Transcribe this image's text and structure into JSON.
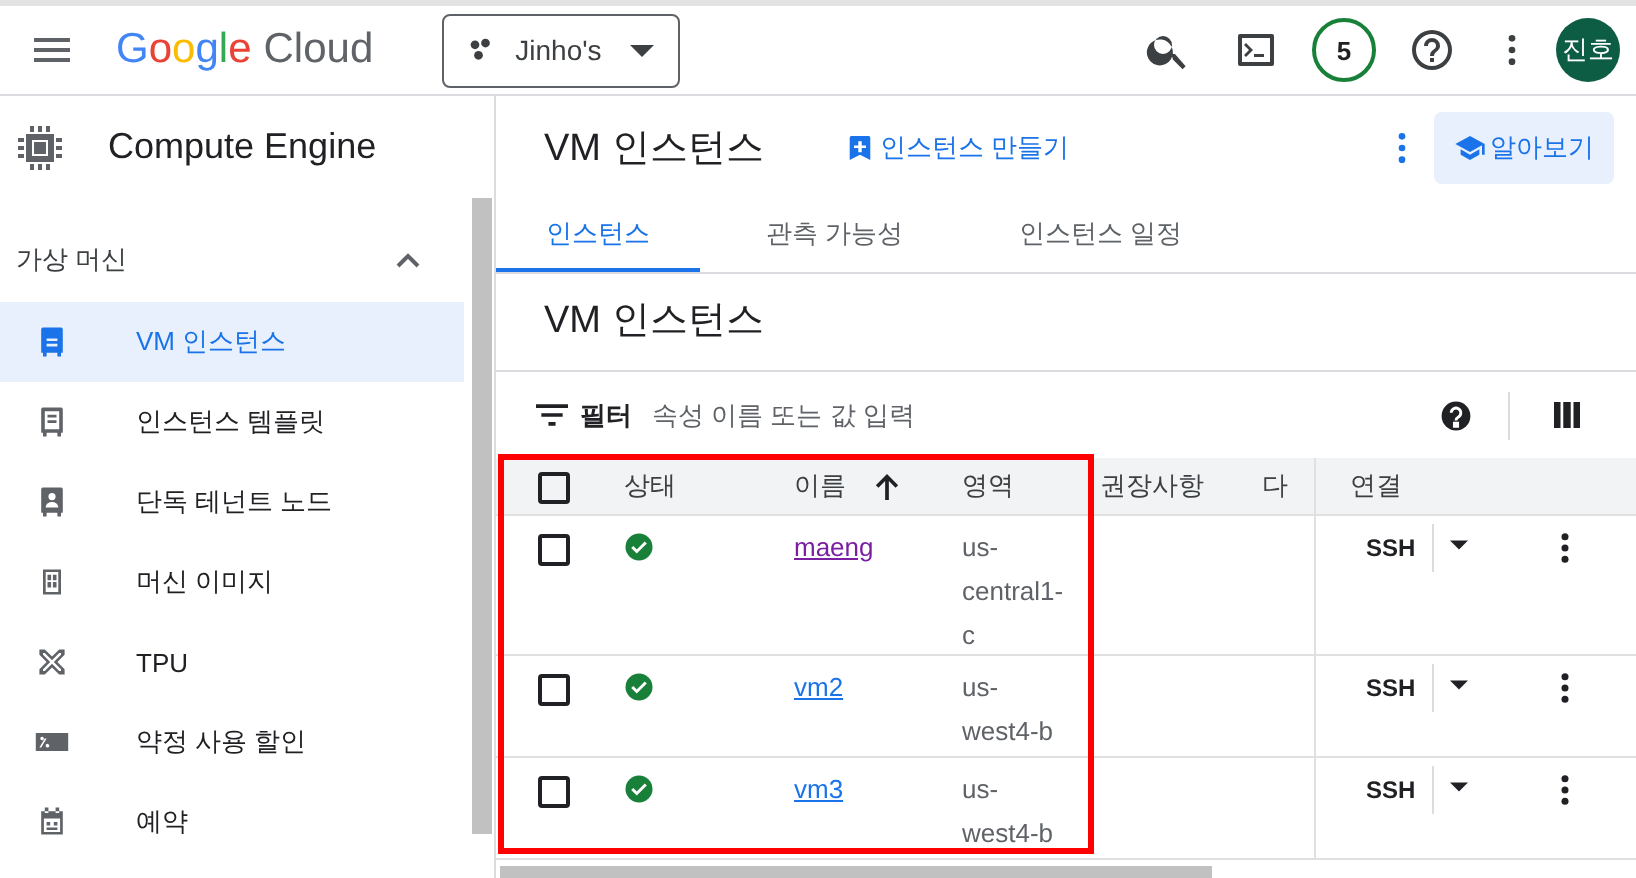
{
  "topbar": {
    "brand": {
      "google": "Google",
      "cloud": "Cloud"
    },
    "project": "Jinho's",
    "notifications": "5",
    "avatar": "진호"
  },
  "product": {
    "name": "Compute Engine"
  },
  "sidebar": {
    "section": {
      "label": "가상 머신",
      "expanded": true
    },
    "items": [
      {
        "label": "VM 인스턴스",
        "kind": "vm",
        "selected": true
      },
      {
        "label": "인스턴스 템플릿",
        "kind": "template",
        "selected": false
      },
      {
        "label": "단독 테넌트 노드",
        "kind": "node",
        "selected": false
      },
      {
        "label": "머신 이미지",
        "kind": "image",
        "selected": false
      },
      {
        "label": "TPU",
        "kind": "tpu",
        "selected": false
      },
      {
        "label": "약정 사용 할인",
        "kind": "discount",
        "selected": false
      },
      {
        "label": "예약",
        "kind": "reservation",
        "selected": false
      }
    ]
  },
  "page": {
    "title": "VM 인스턴스",
    "create": "인스턴스 만들기",
    "learn": "알아보기"
  },
  "tabs": [
    {
      "label": "인스턴스",
      "selected": true
    },
    {
      "label": "관측 가능성",
      "selected": false
    },
    {
      "label": "인스턴스 일정",
      "selected": false
    }
  ],
  "heading": "VM 인스턴스",
  "filter": {
    "label": "필터",
    "placeholder": "속성 이름 또는 값 입력"
  },
  "table": {
    "select_all": {
      "checked": false
    },
    "columns": [
      {
        "label": "상태"
      },
      {
        "label": "이름",
        "sorted_ascending": true
      },
      {
        "label": "영역"
      },
      {
        "label": "권장사항"
      },
      {
        "label": "다"
      },
      {
        "label": "연결"
      }
    ],
    "rows": [
      {
        "checked": false,
        "running": true,
        "name": "maeng",
        "visited": true,
        "zone": "us-central1-c",
        "connect": "SSH"
      },
      {
        "checked": false,
        "running": true,
        "name": "vm2",
        "visited": false,
        "zone": "us-west4-b",
        "connect": "SSH"
      },
      {
        "checked": false,
        "running": true,
        "name": "vm3",
        "visited": false,
        "zone": "us-west4-b",
        "connect": "SSH"
      }
    ]
  },
  "highlight": {
    "shown": true
  }
}
